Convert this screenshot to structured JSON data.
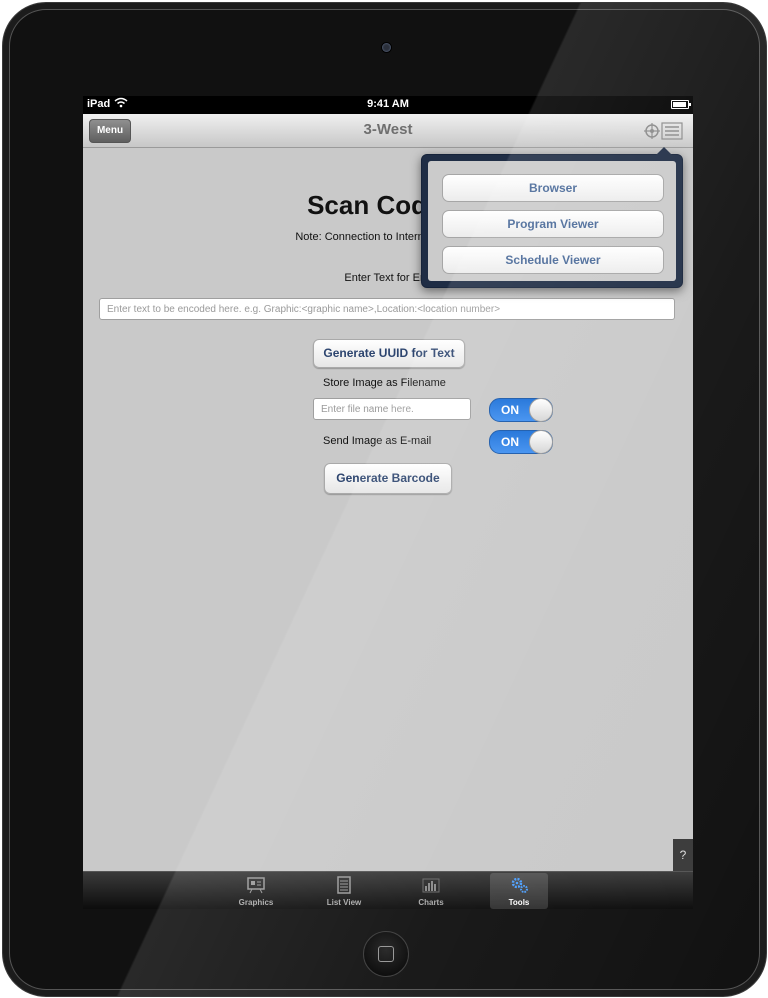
{
  "status_bar": {
    "carrier": "iPad",
    "time": "9:41 AM"
  },
  "navbar": {
    "menu_label": "Menu",
    "title": "3-West",
    "action_icon": "target-list-icon"
  },
  "popover": {
    "items": [
      "Browser",
      "Program Viewer",
      "Schedule Viewer"
    ]
  },
  "main": {
    "title": "Scan Code G",
    "note": "Note: Connection to Internet Required",
    "enter_label": "Enter Text for Enc",
    "encode_placeholder": "Enter text to be encoded here. e.g.  Graphic:<graphic name>,Location:<location number>",
    "uuid_button": "Generate UUID for Text",
    "store_label": "Store Image as Filename",
    "filename_placeholder": "Enter file name here.",
    "store_toggle": "ON",
    "email_label": "Send Image as E-mail",
    "email_toggle": "ON",
    "barcode_button": "Generate Barcode"
  },
  "help_label": "?",
  "tabs": [
    {
      "label": "Graphics",
      "icon": "graphics-icon"
    },
    {
      "label": "List View",
      "icon": "list-view-icon"
    },
    {
      "label": "Charts",
      "icon": "charts-icon"
    },
    {
      "label": "Tools",
      "icon": "gears-icon",
      "active": true
    }
  ],
  "colors": {
    "toggle_on": "#1a6fd8",
    "button_text": "#2d456f",
    "popover_border": "#1f2d45"
  }
}
